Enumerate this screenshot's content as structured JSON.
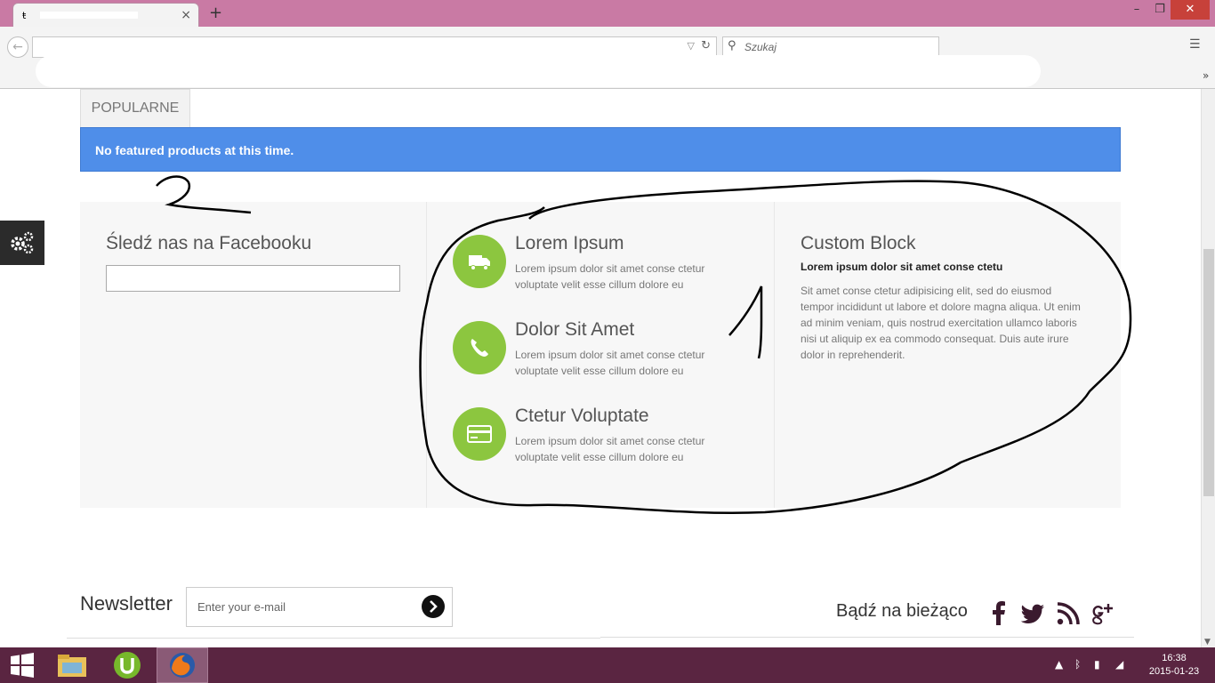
{
  "browser": {
    "tab_close": "×",
    "new_tab": "+",
    "window_buttons": {
      "minimize": "–",
      "restore": "❐",
      "close": "✕"
    },
    "search_placeholder": "Szukaj",
    "bookmarks_more": "»"
  },
  "page": {
    "popular_tab": "POPULARNE",
    "alert": "No featured products at this time."
  },
  "facebook": {
    "title": "Śledź nas na Facebooku"
  },
  "services": [
    {
      "title": "Lorem Ipsum",
      "desc": "Lorem ipsum dolor sit amet conse ctetur voluptate velit esse cillum dolore eu",
      "icon": "truck-icon"
    },
    {
      "title": "Dolor Sit Amet",
      "desc": "Lorem ipsum dolor sit amet conse ctetur voluptate velit esse cillum dolore eu",
      "icon": "phone-icon"
    },
    {
      "title": "Ctetur Voluptate",
      "desc": "Lorem ipsum dolor sit amet conse ctetur voluptate velit esse cillum dolore eu",
      "icon": "credit-card-icon"
    }
  ],
  "custom_block": {
    "title": "Custom Block",
    "bold": "Lorem ipsum dolor sit amet conse ctetu",
    "text": "Sit amet conse ctetur adipisicing elit, sed do eiusmod tempor incididunt ut labore et dolore magna aliqua. Ut enim ad minim veniam, quis nostrud exercitation ullamco laboris nisi ut aliquip ex ea commodo consequat. Duis aute irure dolor in reprehenderit."
  },
  "newsletter": {
    "label": "Newsletter",
    "placeholder": "Enter your e-mail"
  },
  "social": {
    "label": "Bądź na bieżąco",
    "icons": [
      "facebook-icon",
      "twitter-icon",
      "rss-icon",
      "google-plus-icon"
    ]
  },
  "taskbar": {
    "time": "16:38",
    "date": "2015-01-23"
  },
  "colors": {
    "alert": "#4f8ee9",
    "service_circle": "#8cc63f",
    "titlebar": "#c97aa4",
    "taskbar": "#5a2541"
  }
}
